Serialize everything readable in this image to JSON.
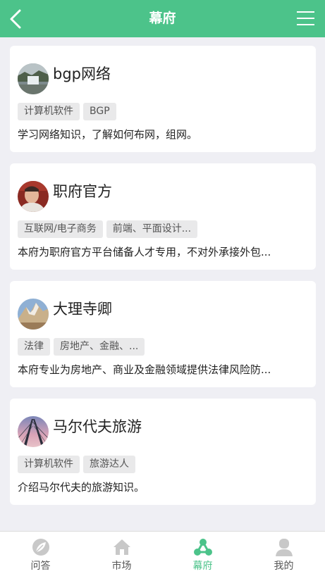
{
  "header": {
    "title": "幕府"
  },
  "cards": [
    {
      "name": "bgp网络",
      "tags": [
        "计算机软件",
        "BGP"
      ],
      "desc": "学习网络知识，了解如何布网，组网。"
    },
    {
      "name": "职府官方",
      "tags": [
        "互联网/电子商务",
        "前端、平面设计..."
      ],
      "desc": "本府为职府官方平台储备人才专用，不对外承接外包..."
    },
    {
      "name": "大理寺卿",
      "tags": [
        "法律",
        "房地产、金融、..."
      ],
      "desc": "本府专业为房地产、商业及金融领域提供法律风险防..."
    },
    {
      "name": "马尔代夫旅游",
      "tags": [
        "计算机软件",
        "旅游达人"
      ],
      "desc": "介绍马尔代夫的旅游知识。"
    }
  ],
  "tabbar": {
    "items": [
      {
        "label": "问答",
        "icon": "leaf-icon"
      },
      {
        "label": "市场",
        "icon": "home-icon"
      },
      {
        "label": "幕府",
        "icon": "network-icon"
      },
      {
        "label": "我的",
        "icon": "user-icon"
      }
    ],
    "active": "幕府"
  },
  "colors": {
    "accent": "#4cc38a",
    "background": "#efeff4",
    "tag_bg": "#e9e9ea"
  }
}
